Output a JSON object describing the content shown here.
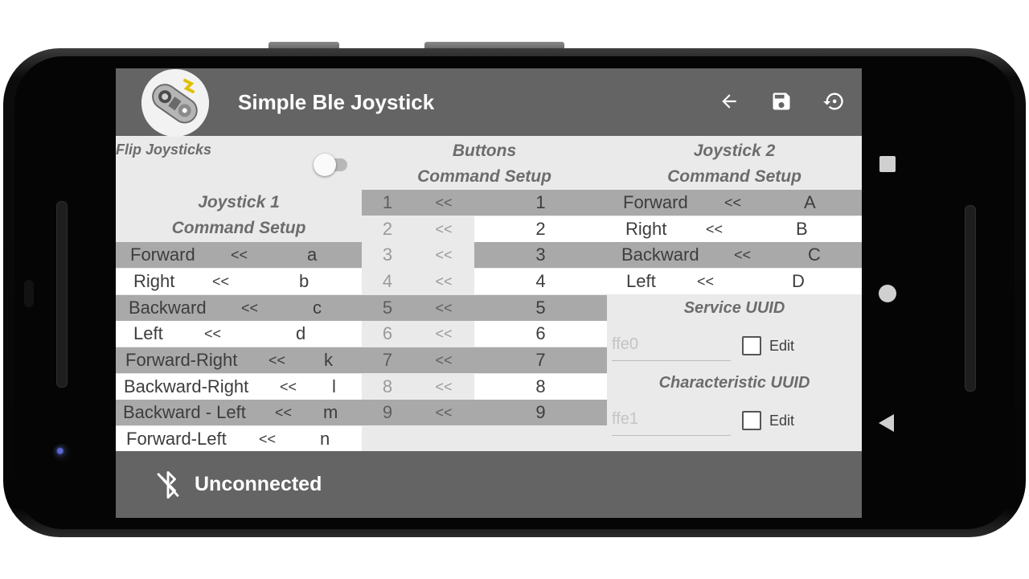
{
  "app": {
    "title": "Simple Ble Joystick"
  },
  "toolbar": {
    "icons": [
      "arrow-back-icon",
      "save-icon",
      "restore-icon"
    ]
  },
  "flip": {
    "label": "Flip Joysticks",
    "enabled": false
  },
  "joystick1": {
    "header_line1": "Joystick 1",
    "header_line2": "Command Setup",
    "rows": [
      {
        "label": "Forward",
        "arrow": "<<",
        "value": "a"
      },
      {
        "label": "Right",
        "arrow": "<<",
        "value": "b"
      },
      {
        "label": "Backward",
        "arrow": "<<",
        "value": "c"
      },
      {
        "label": "Left",
        "arrow": "<<",
        "value": "d"
      },
      {
        "label": "Forward-Right",
        "arrow": "<<",
        "value": "k"
      },
      {
        "label": "Backward-Right",
        "arrow": "<<",
        "value": "l"
      },
      {
        "label": "Backward - Left",
        "arrow": "<<",
        "value": "m"
      },
      {
        "label": "Forward-Left",
        "arrow": "<<",
        "value": "n"
      }
    ]
  },
  "buttons": {
    "header_line1": "Buttons",
    "header_line2": "Command Setup",
    "rows": [
      {
        "num": "1",
        "arrow": "<<",
        "value": "1"
      },
      {
        "num": "2",
        "arrow": "<<",
        "value": "2"
      },
      {
        "num": "3",
        "arrow": "<<",
        "value": "3"
      },
      {
        "num": "4",
        "arrow": "<<",
        "value": "4"
      },
      {
        "num": "5",
        "arrow": "<<",
        "value": "5"
      },
      {
        "num": "6",
        "arrow": "<<",
        "value": "6"
      },
      {
        "num": "7",
        "arrow": "<<",
        "value": "7"
      },
      {
        "num": "8",
        "arrow": "<<",
        "value": "8"
      },
      {
        "num": "9",
        "arrow": "<<",
        "value": "9"
      }
    ]
  },
  "joystick2": {
    "header_line1": "Joystick 2",
    "header_line2": "Command Setup",
    "rows": [
      {
        "label": "Forward",
        "arrow": "<<",
        "value": "A"
      },
      {
        "label": "Right",
        "arrow": "<<",
        "value": "B"
      },
      {
        "label": "Backward",
        "arrow": "<<",
        "value": "C"
      },
      {
        "label": "Left",
        "arrow": "<<",
        "value": "D"
      }
    ]
  },
  "service_uuid": {
    "label": "Service UUID",
    "placeholder": "ffe0",
    "edit_label": "Edit",
    "edit_checked": false
  },
  "characteristic_uuid": {
    "label": "Characteristic UUID",
    "placeholder": "ffe1",
    "edit_label": "Edit",
    "edit_checked": false
  },
  "status": {
    "text": "Unconnected",
    "icon": "bluetooth-disabled-icon"
  },
  "system_nav": {
    "icons": [
      "recents-square-icon",
      "home-circle-icon",
      "back-triangle-icon"
    ]
  }
}
